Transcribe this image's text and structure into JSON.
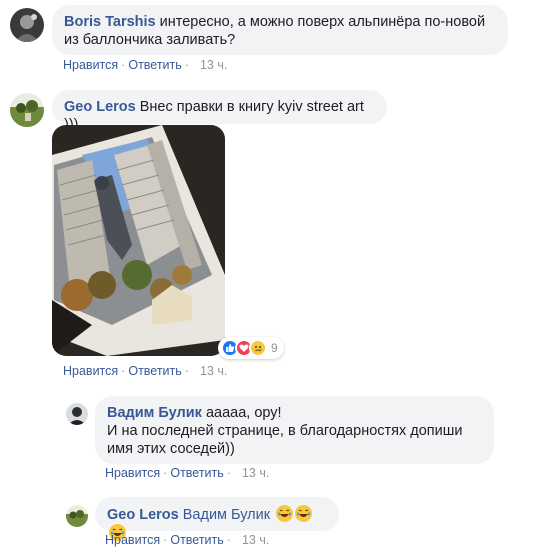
{
  "comments": [
    {
      "author": "Boris Tarshis",
      "text_line1": "интересно, а можно поверх альпинёра по-новой",
      "text_line2": "из баллончика заливать?",
      "like": "Нравится",
      "reply": "Ответить",
      "time": "13 ч."
    },
    {
      "author": "Geo Leros",
      "text": "Внес правки в книгу kyiv street art )))",
      "like": "Нравится",
      "reply": "Ответить",
      "time": "13 ч.",
      "reactions_count": "9"
    }
  ],
  "replies": [
    {
      "author": "Вадим Булик",
      "text_line1": "ааааа, ору!",
      "text_line2": "И на последней странице, в благодарностях допиши",
      "text_line3": "имя этих соседей))",
      "like": "Нравится",
      "reply": "Ответить",
      "time": "13 ч."
    },
    {
      "author": "Geo Leros",
      "mention": "Вадим Булик",
      "like": "Нравится",
      "reply": "Ответить",
      "time": "13 ч."
    }
  ],
  "colors": {
    "link": "#385898",
    "bubble": "#f2f3f5",
    "meta": "#90949c",
    "like_blue": "#1877f2",
    "love_red": "#f33e58"
  },
  "icons": [
    "avatar-boris",
    "avatar-geo",
    "avatar-vadim",
    "like-reaction-icon",
    "love-reaction-icon",
    "sad-reaction-icon",
    "laughing-emoji-icon"
  ]
}
